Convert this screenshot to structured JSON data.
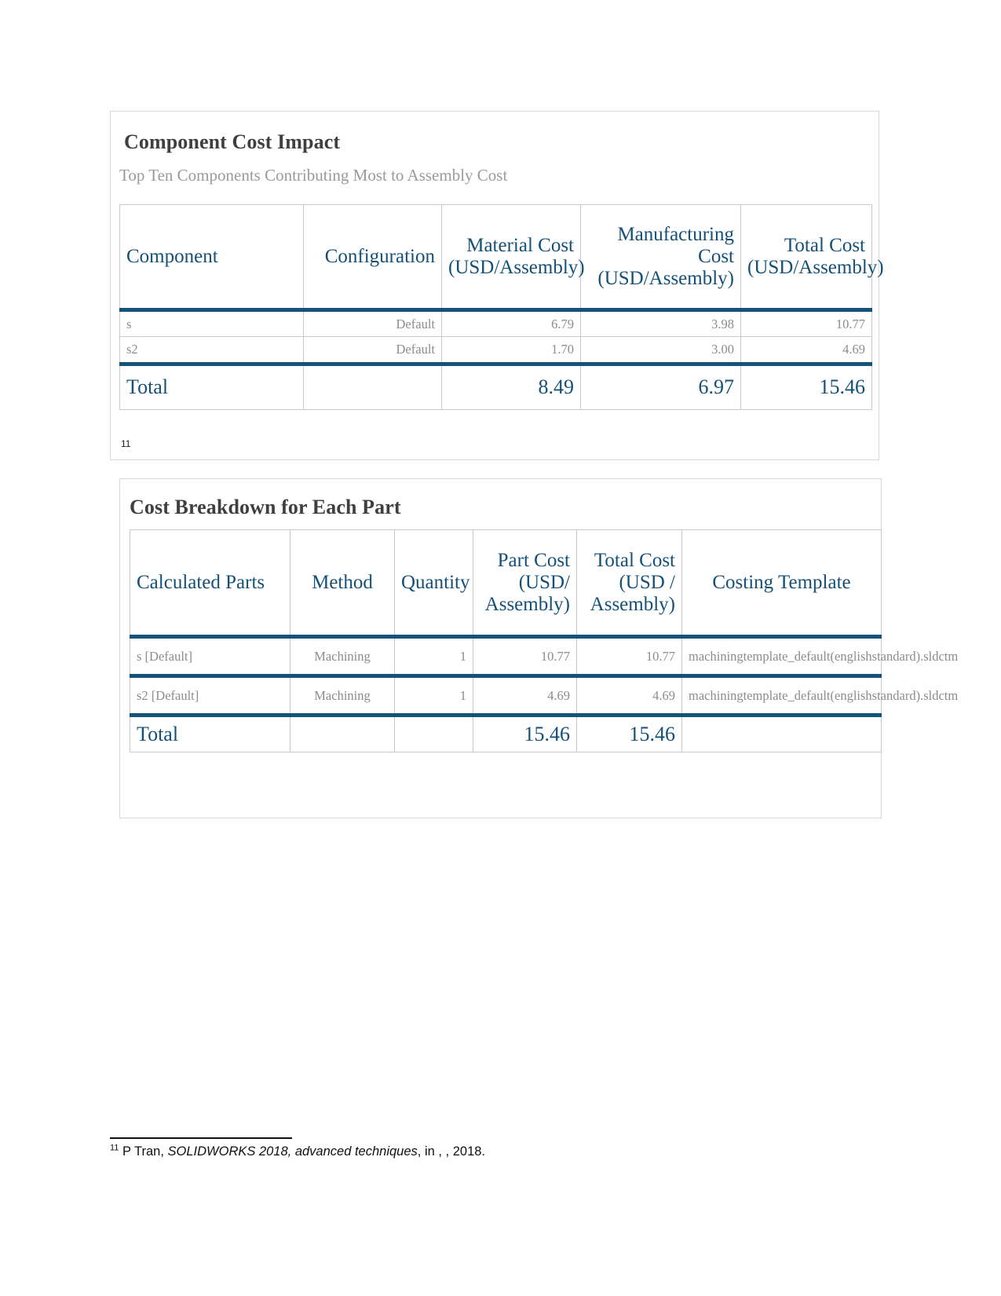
{
  "document": {
    "footnote": {
      "marker": "11",
      "author": "P Tran,",
      "title_italic": "SOLIDWORKS 2018, advanced techniques",
      "tail": ", in , , 2018."
    }
  },
  "cards": [
    {
      "id": "component-cost-impact",
      "title": "Component Cost Impact",
      "subtitle": "Top Ten Components Contributing Most to Assembly Cost",
      "footnote_ref": "11"
    },
    {
      "id": "cost-breakdown-for-each-part",
      "title": "Cost Breakdown for Each Part"
    }
  ],
  "table_one": {
    "headers": [
      "Component",
      "Configuration",
      "Material Cost (USD/Assembly)",
      "Manufacturing Cost (USD/Assembly)",
      "Total Cost (USD/Assembly)"
    ],
    "rows": [
      {
        "component": "s",
        "configuration": "Default",
        "material_cost": "6.79",
        "manufacturing_cost": "3.98",
        "total_cost": "10.77"
      },
      {
        "component": "s2",
        "configuration": "Default",
        "material_cost": "1.70",
        "manufacturing_cost": "3.00",
        "total_cost": "4.69"
      }
    ],
    "total": {
      "label": "Total",
      "configuration": "",
      "material_cost": "8.49",
      "manufacturing_cost": "6.97",
      "total_cost": "15.46"
    }
  },
  "table_two": {
    "headers": [
      "Calculated Parts",
      "Method",
      "Quantity",
      "Part Cost (USD/ Assembly)",
      "Total Cost (USD / Assembly)",
      "Costing Template"
    ],
    "rows": [
      {
        "part": "s [Default]",
        "method": "Machining",
        "quantity": "1",
        "part_cost": "10.77",
        "total_cost": "10.77",
        "costing_template": "machiningtemplate_default(englishstandard).sldctm"
      },
      {
        "part": "s2 [Default]",
        "method": "Machining",
        "quantity": "1",
        "part_cost": "4.69",
        "total_cost": "4.69",
        "costing_template": "machiningtemplate_default(englishstandard).sldctm"
      }
    ],
    "total": {
      "label": "Total",
      "method": "",
      "quantity": "",
      "part_cost": "15.46",
      "total_cost": "15.46",
      "costing_template": ""
    }
  },
  "colors": {
    "accent_blue": "#145078",
    "rule_blue": "#14537a",
    "title_gray": "#3f3f3f",
    "subtitle_gray": "#9a9a9a",
    "body_gray": "#8c8c8c",
    "cell_border": "#c9c9c9",
    "card_border": "#d8d8d8"
  }
}
